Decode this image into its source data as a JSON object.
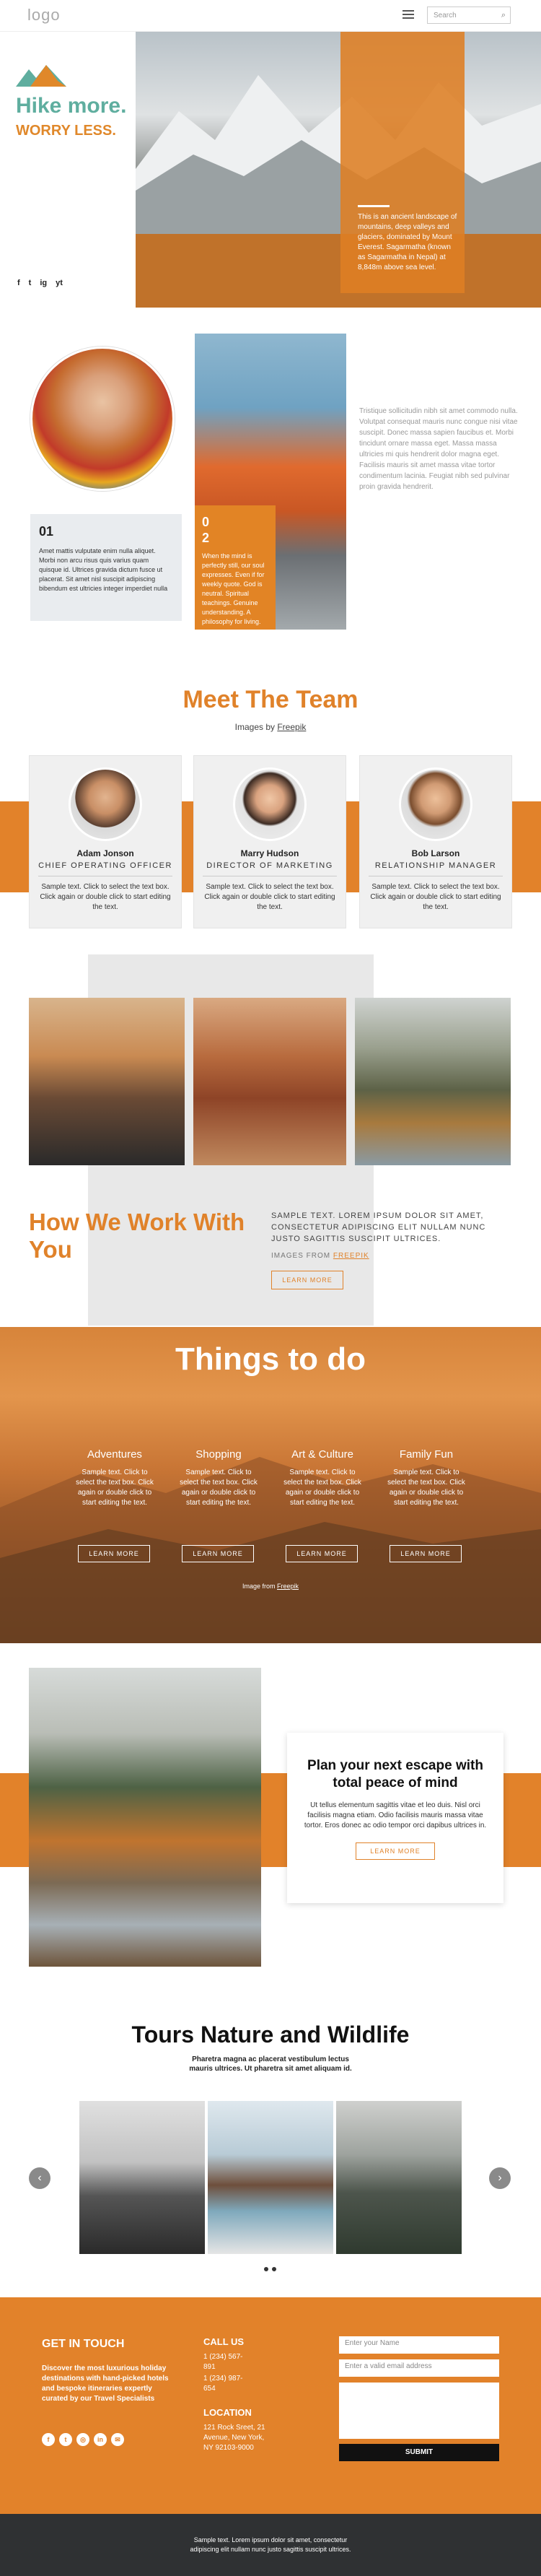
{
  "header": {
    "logo": "logo",
    "search_placeholder": "Search"
  },
  "hero": {
    "title": "Hike more.",
    "subtitle": "WORRY LESS.",
    "text": "This is an ancient landscape of mountains, deep valleys and glaciers, dominated by Mount Everest. Sagarmatha (known as Sagarmatha in Nepal) at 8,848m above sea level.",
    "social": [
      "f",
      "t",
      "ig",
      "yt"
    ]
  },
  "about": {
    "card1_num": "01",
    "card1_text": "Amet mattis vulputate enim nulla aliquet. Morbi non arcu risus quis varius quam quisque id. Ultrices gravida dictum fusce ut placerat. Sit amet nisl suscipit adipiscing bibendum est ultricies integer imperdiet nulla",
    "card2_num": "0\n2",
    "card2_text": "When the mind is perfectly still, our soul expresses. Even if for weekly quote. God is neutral. Spiritual teachings. Genuine understanding. A philosophy for living.",
    "side_text": "Tristique sollicitudin nibh sit amet commodo nulla. Volutpat consequat mauris nunc congue nisi vitae suscipit. Donec massa sapien faucibus et. Morbi tincidunt ornare massa eget. Massa massa ultricies mi quis hendrerit dolor magna eget. Facilisis mauris sit amet massa vitae tortor condimentum lacinia. Feugiat nibh sed pulvinar proin gravida hendrerit."
  },
  "team": {
    "title": "Meet The Team",
    "credit_prefix": "Images by ",
    "credit_link": "Freepik",
    "members": [
      {
        "name": "Adam Jonson",
        "role": "CHIEF OPERATING OFFICER",
        "text": "Sample text. Click to select the text box. Click again or double click to start editing the text."
      },
      {
        "name": "Marry Hudson",
        "role": "DIRECTOR OF MARKETING",
        "text": "Sample text. Click to select the text box. Click again or double click to start editing the text."
      },
      {
        "name": "Bob Larson",
        "role": "RELATIONSHIP MANAGER",
        "text": "Sample text. Click to select the text box. Click again or double click to start editing the text."
      }
    ]
  },
  "howwework": {
    "title": "How We Work With You",
    "text": "SAMPLE TEXT. LOREM IPSUM DOLOR SIT AMET, CONSECTETUR ADIPISCING ELIT NULLAM NUNC JUSTO SAGITTIS SUSCIPIT ULTRICES.",
    "credit_prefix": "IMAGES FROM ",
    "credit_link": "FREEPIK",
    "button": "LEARN MORE"
  },
  "things": {
    "title": "Things to do",
    "items": [
      {
        "heading": "Adventures",
        "text": "Sample text. Click to select the text box. Click again or double click to start editing the text.",
        "button": "LEARN MORE"
      },
      {
        "heading": "Shopping",
        "text": "Sample text. Click to select the text box. Click again or double click to start editing the text.",
        "button": "LEARN MORE"
      },
      {
        "heading": "Art & Culture",
        "text": "Sample text. Click to select the text box. Click again or double click to start editing the text.",
        "button": "LEARN MORE"
      },
      {
        "heading": "Family Fun",
        "text": "Sample text. Click to select the text box. Click again or double click to start editing the text.",
        "button": "LEARN MORE"
      }
    ],
    "credit_prefix": "Image from ",
    "credit_link": "Freepik"
  },
  "plan": {
    "title": "Plan your next escape with total peace of mind",
    "text": "Ut tellus elementum sagittis vitae et leo duis. Nisl orci facilisis magna etiam. Odio facilisis mauris massa vitae tortor. Eros donec ac odio tempor orci dapibus ultrices in.",
    "button": "LEARN MORE"
  },
  "tours": {
    "title": "Tours Nature and Wildlife",
    "subtitle": "Pharetra magna ac placerat vestibulum lectus mauris ultrices. Ut pharetra sit amet aliquam id.",
    "prev": "‹",
    "next": "›"
  },
  "footer": {
    "touch_title": "GET IN TOUCH",
    "touch_text": "Discover the most luxurious holiday destinations with hand-picked hotels and bespoke itineraries expertly curated by our Travel Specialists",
    "call_title": "CALL US",
    "phone1": "1 (234) 567-891",
    "phone2": "1 (234) 987-654",
    "location_title": "LOCATION",
    "address": "121 Rock Sreet, 21 Avenue, New York, NY 92103-9000",
    "name_placeholder": "Enter your Name",
    "email_placeholder": "Enter a valid email address",
    "submit": "SUBMIT",
    "social": [
      "f",
      "t",
      "◎",
      "in",
      "✉"
    ],
    "bottom_text": "Sample text. Lorem ipsum dolor sit amet, consectetur adipiscing elit nullam nunc justo sagittis suscipit ultrices."
  },
  "colors": {
    "accent": "#e2822a",
    "teal": "#5fae9f",
    "dark": "#2f3133"
  }
}
